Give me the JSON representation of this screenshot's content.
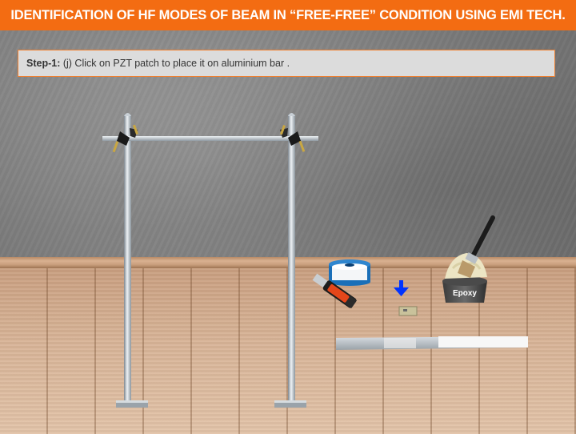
{
  "title": "IDENTIFICATION OF HF MODES OF BEAM IN “FREE-FREE” CONDITION USING EMI TECH.",
  "instruction": {
    "step_label": "Step-1:",
    "text": " (j) Click on PZT patch to place it on aluminium bar ."
  },
  "objects": {
    "epoxy_label": "Epoxy"
  },
  "colors": {
    "header_bg": "#f36c12",
    "instruction_border": "#f08030",
    "arrow": "#0033ff"
  },
  "icons": [
    "stand-frame",
    "clamp-icon",
    "cutter-icon",
    "solder-wire-spool-icon",
    "down-arrow-icon",
    "pzt-patch-icon",
    "epoxy-bucket-icon",
    "brush-icon",
    "aluminium-bar"
  ]
}
